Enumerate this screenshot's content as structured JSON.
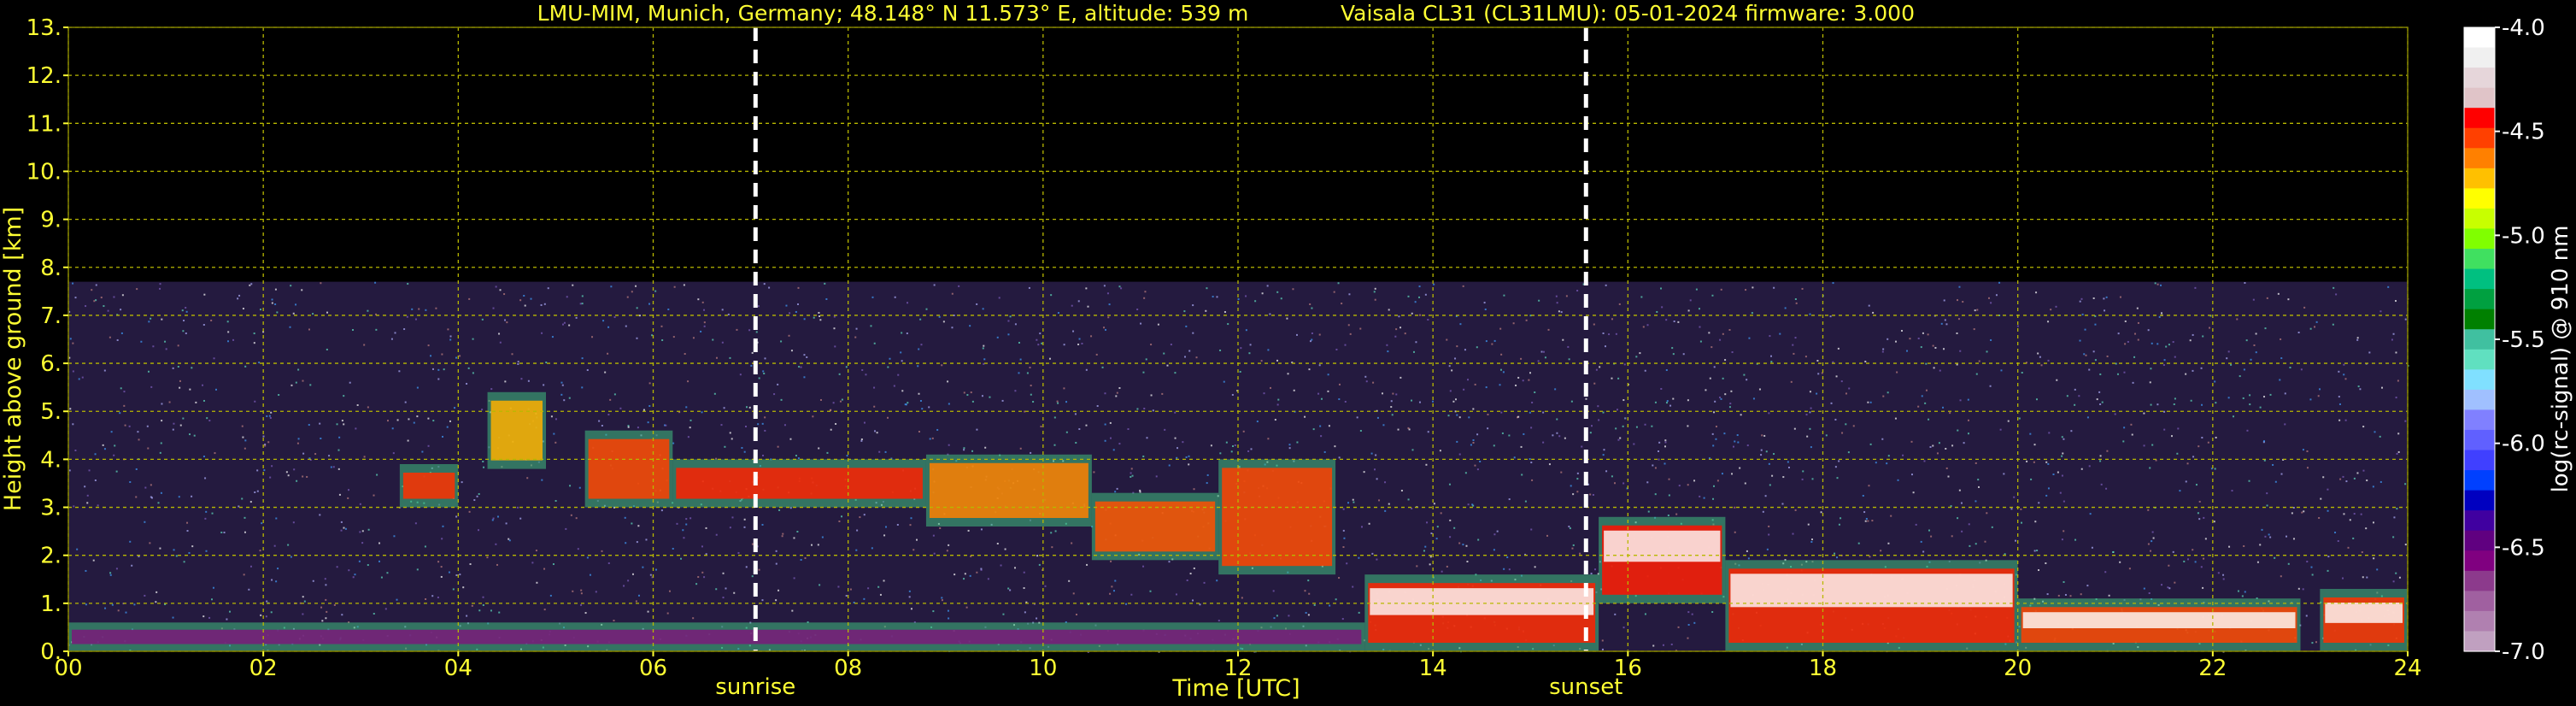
{
  "chart_data": {
    "type": "heatmap",
    "title_left": "LMU-MIM, Munich, Germany; 48.148° N 11.573° E, altitude: 539 m",
    "title_right": "Vaisala CL31 (CL31LMU): 05-01-2024    firmware: 3.000",
    "xlabel": "Time [UTC]",
    "ylabel": "Height above ground [km]",
    "xlim": [
      0,
      24
    ],
    "ylim": [
      0,
      13
    ],
    "grid": true,
    "x_ticks": [
      "00",
      "02",
      "04",
      "06",
      "08",
      "10",
      "12",
      "14",
      "16",
      "18",
      "20",
      "22",
      "24"
    ],
    "y_ticks": [
      "0.",
      "1.",
      "2.",
      "3.",
      "4.",
      "5.",
      "6.",
      "7.",
      "8.",
      "9.",
      "10.",
      "11.",
      "12.",
      "13."
    ],
    "annotations": [
      {
        "label": "sunrise",
        "x": 7.05
      },
      {
        "label": "sunset",
        "x": 15.57
      }
    ],
    "colorbar": {
      "label": "log(rc-signal) @ 910 nm",
      "range": [
        -7.0,
        -4.0
      ],
      "ticks": [
        "-4.0",
        "-4.5",
        "-5.0",
        "-5.5",
        "-6.0",
        "-6.5",
        "-7.0"
      ],
      "colors": [
        "#ffffff",
        "#f0f0f0",
        "#e6d6da",
        "#e0c4c8",
        "#ff0000",
        "#ff4000",
        "#ff8000",
        "#ffc000",
        "#ffff00",
        "#c8ff00",
        "#80ff00",
        "#40e060",
        "#00c080",
        "#00a040",
        "#008000",
        "#40c0a0",
        "#60e0c0",
        "#80e0ff",
        "#a0c0ff",
        "#8080ff",
        "#6060ff",
        "#4040ff",
        "#0040ff",
        "#0000c0",
        "#4000a0",
        "#600080",
        "#800080",
        "#8c3a8c",
        "#a060a0",
        "#b080b0",
        "#c0a0c0"
      ]
    },
    "max_signal_height_km": 7.7,
    "layers": [
      {
        "name": "surface-layer",
        "t": [
          0,
          13.3
        ],
        "h": [
          0,
          0.6
        ],
        "color": "#7a1a7a"
      },
      {
        "name": "aerosol-layer",
        "t": [
          3.4,
          4.0
        ],
        "h": [
          3.0,
          3.9
        ],
        "color": "#ff3000"
      },
      {
        "name": "aerosol-layer",
        "t": [
          4.3,
          4.9
        ],
        "h": [
          3.8,
          5.4
        ],
        "color": "#ffb000"
      },
      {
        "name": "aerosol-layer",
        "t": [
          5.3,
          6.2
        ],
        "h": [
          3.0,
          4.6
        ],
        "color": "#ff4000"
      },
      {
        "name": "aerosol-layer",
        "t": [
          6.2,
          8.8
        ],
        "h": [
          3.0,
          4.0
        ],
        "color": "#ff2000"
      },
      {
        "name": "aerosol-layer",
        "t": [
          8.8,
          10.5
        ],
        "h": [
          2.6,
          4.1
        ],
        "color": "#ff8000"
      },
      {
        "name": "aerosol-layer",
        "t": [
          10.5,
          11.8
        ],
        "h": [
          1.9,
          3.3
        ],
        "color": "#ff5000"
      },
      {
        "name": "aerosol-layer",
        "t": [
          11.8,
          13.0
        ],
        "h": [
          1.6,
          4.0
        ],
        "color": "#ff4000"
      },
      {
        "name": "boundary-layer",
        "t": [
          13.3,
          15.7
        ],
        "h": [
          0.0,
          1.6
        ],
        "color": "#ff2000"
      },
      {
        "name": "boundary-layer",
        "t": [
          15.7,
          17.0
        ],
        "h": [
          1.0,
          2.8
        ],
        "color": "#ff1000"
      },
      {
        "name": "boundary-layer",
        "t": [
          17.0,
          20.0
        ],
        "h": [
          0.0,
          1.9
        ],
        "color": "#ff2000"
      },
      {
        "name": "boundary-layer",
        "t": [
          20.0,
          22.9
        ],
        "h": [
          0.0,
          1.1
        ],
        "color": "#ff4000"
      },
      {
        "name": "boundary-layer",
        "t": [
          23.1,
          24.0
        ],
        "h": [
          0.0,
          1.3
        ],
        "color": "#ff3000"
      }
    ]
  }
}
